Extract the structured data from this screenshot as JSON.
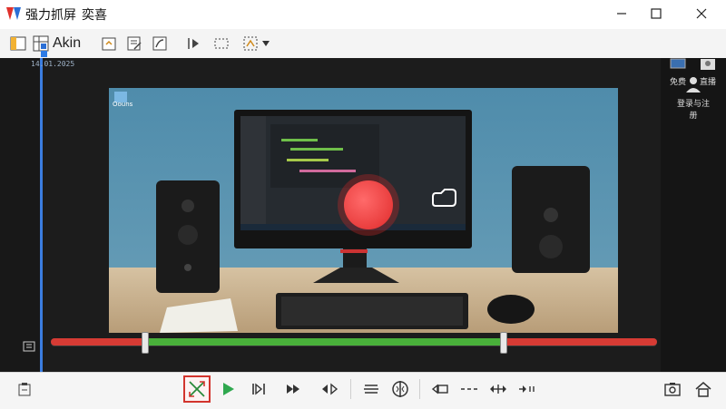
{
  "window": {
    "title": "强力抓屏",
    "subtitle": "奕喜",
    "controls": [
      "minimize",
      "maximize",
      "close"
    ]
  },
  "toolbar": {
    "items": [
      {
        "icon": "panel-icon"
      },
      {
        "icon": "layout-icon",
        "label": "Akin"
      },
      {
        "icon": "export-icon"
      },
      {
        "icon": "edit-icon"
      },
      {
        "icon": "curve-icon"
      },
      {
        "icon": "play-to-icon"
      },
      {
        "icon": "select-region-icon"
      },
      {
        "icon": "effects-icon",
        "dropdown": true
      }
    ]
  },
  "video": {
    "timestamp_label": "14.01.2025",
    "desktop_icon_label": "Oouns",
    "side_panel": [
      {
        "icon": "chat-icon",
        "label": "免费"
      },
      {
        "icon": "profile-icon",
        "label": "直播"
      },
      {
        "icon": "person-icon",
        "label": "登录与注册"
      }
    ]
  },
  "timeline": {
    "colors": {
      "trim": "#d63b34",
      "selected": "#49b03a"
    },
    "selection_start_fraction": 0.156,
    "selection_end_fraction": 0.745
  },
  "bottombar": {
    "buttons": [
      {
        "icon": "clipboard-icon"
      },
      {
        "icon": "trim-mode-icon",
        "active": true
      },
      {
        "icon": "play-icon"
      },
      {
        "icon": "next-frame-icon"
      },
      {
        "icon": "fast-forward-icon"
      },
      {
        "icon": "mark-icon"
      },
      {
        "icon": "align-icon"
      },
      {
        "icon": "split-icon"
      },
      {
        "icon": "camera-left-icon"
      },
      {
        "icon": "dash-icon"
      },
      {
        "icon": "expand-icon"
      },
      {
        "icon": "contract-icon"
      },
      {
        "icon": "screenshot-icon"
      },
      {
        "icon": "home-icon"
      }
    ]
  }
}
